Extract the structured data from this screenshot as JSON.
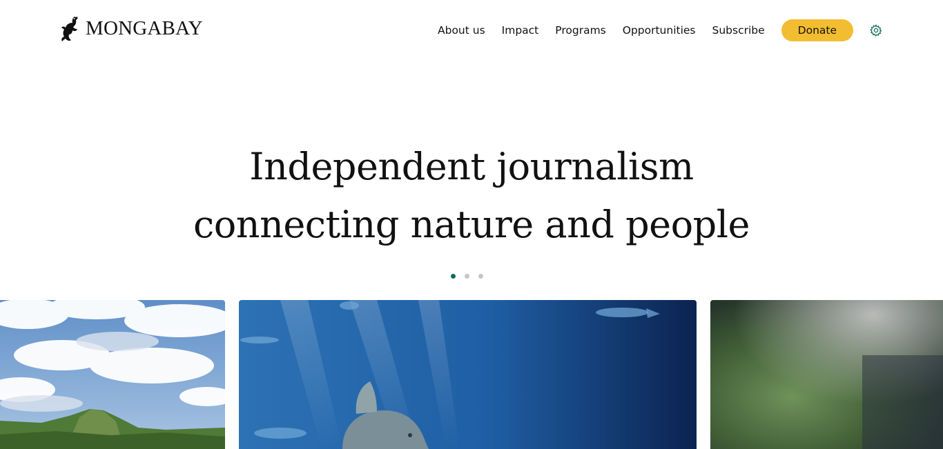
{
  "brand": {
    "name": "MONGABAY",
    "logo_icon": "gecko-icon"
  },
  "nav": {
    "items": [
      {
        "label": "About us"
      },
      {
        "label": "Impact"
      },
      {
        "label": "Programs"
      },
      {
        "label": "Opportunities"
      },
      {
        "label": "Subscribe"
      }
    ],
    "donate_label": "Donate",
    "settings_icon": "gear-icon"
  },
  "hero": {
    "line1": "Independent journalism",
    "line2": "connecting nature and people"
  },
  "carousel": {
    "slide_count": 3,
    "active_index": 0
  },
  "images": [
    {
      "subject": "forested hill under cloudy sky"
    },
    {
      "subject": "ocean sunfish underwater"
    },
    {
      "subject": "blurred green foliage"
    }
  ],
  "colors": {
    "accent": "#0e6e58",
    "donate": "#f2bd30",
    "text": "#111111"
  }
}
